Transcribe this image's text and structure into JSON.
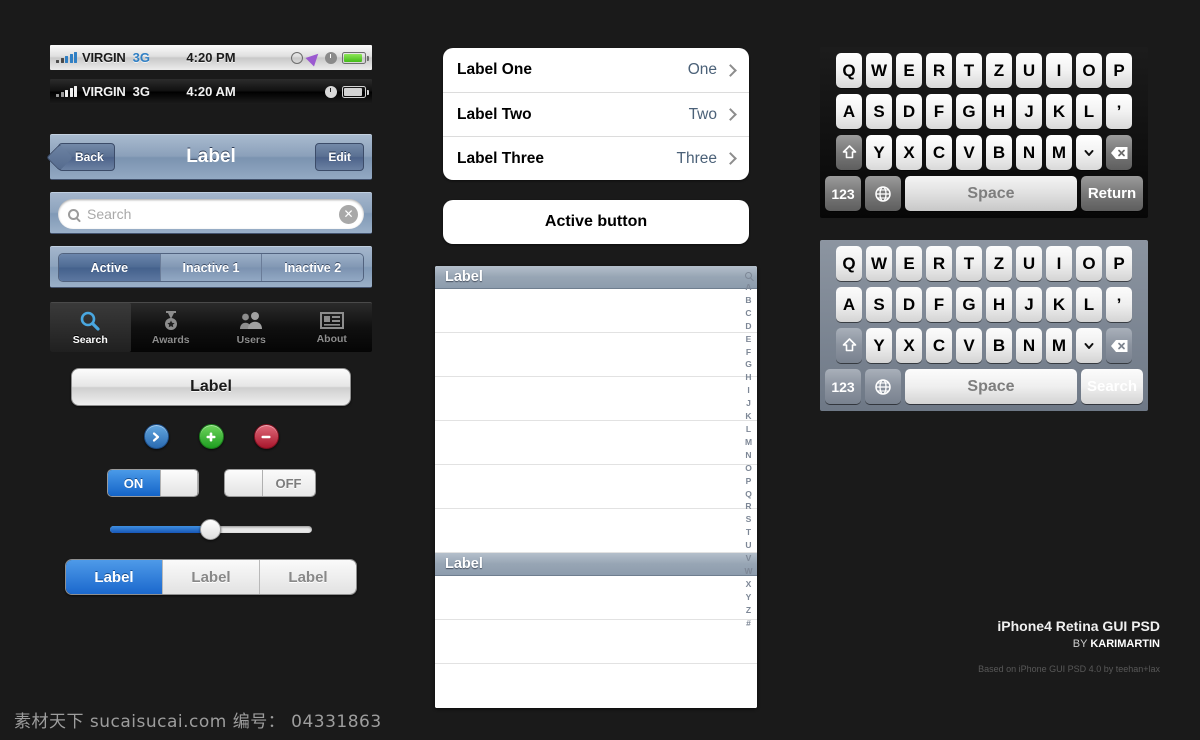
{
  "background": "#1a1a1a",
  "status_bars": [
    {
      "style": "light",
      "carrier": "VIRGIN",
      "network": "3G",
      "time": "4:20 PM",
      "icons": [
        "rotation-lock-icon",
        "location-arrow-icon",
        "alarm-clock-icon",
        "battery-icon"
      ]
    },
    {
      "style": "dark",
      "carrier": "VIRGIN",
      "network": "3G",
      "time": "4:20 AM",
      "icons": [
        "alarm-clock-icon",
        "battery-icon"
      ]
    }
  ],
  "navbar": {
    "back_label": "Back",
    "title": "Label",
    "edit_label": "Edit"
  },
  "searchbar": {
    "placeholder": "Search",
    "value": ""
  },
  "segmented_top": {
    "items": [
      "Active",
      "Inactive 1",
      "Inactive 2"
    ],
    "selected_index": 0
  },
  "tabbar": {
    "items": [
      {
        "label": "Search",
        "icon": "search-icon",
        "active": true
      },
      {
        "label": "Awards",
        "icon": "medal-icon",
        "active": false
      },
      {
        "label": "Users",
        "icon": "users-icon",
        "active": false
      },
      {
        "label": "About",
        "icon": "contact-card-icon",
        "active": false
      }
    ]
  },
  "gray_button": {
    "label": "Label"
  },
  "round_buttons": [
    {
      "name": "disclosure-button",
      "icon": "chevron-right-icon",
      "color": "#2a6ab0"
    },
    {
      "name": "add-button",
      "icon": "plus-icon",
      "color": "#1f9d21"
    },
    {
      "name": "delete-button",
      "icon": "minus-icon",
      "color": "#a8162c"
    }
  ],
  "switches": [
    {
      "state": "on",
      "label": "ON"
    },
    {
      "state": "off",
      "label": "OFF"
    }
  ],
  "slider": {
    "value": 50,
    "min": 0,
    "max": 100
  },
  "segmented_bottom": {
    "items": [
      "Label",
      "Label",
      "Label"
    ],
    "selected_index": 0
  },
  "grouped_table": {
    "rows": [
      {
        "label": "Label One",
        "value": "One"
      },
      {
        "label": "Label Two",
        "value": "Two"
      },
      {
        "label": "Label Three",
        "value": "Three"
      }
    ]
  },
  "active_button": {
    "label": "Active button"
  },
  "plain_table": {
    "section_one_header": "Label",
    "section_two_header": "Label",
    "section_one_row_count": 6,
    "section_two_row_count": 3,
    "index_bar": [
      "A",
      "B",
      "C",
      "D",
      "E",
      "F",
      "G",
      "H",
      "I",
      "J",
      "K",
      "L",
      "M",
      "N",
      "O",
      "P",
      "Q",
      "R",
      "S",
      "T",
      "U",
      "V",
      "W",
      "X",
      "Y",
      "Z",
      "#"
    ],
    "index_search_icon": "search-icon"
  },
  "keyboards": [
    {
      "theme": "dark",
      "row1": [
        "Q",
        "W",
        "E",
        "R",
        "T",
        "Z",
        "U",
        "I",
        "O",
        "P"
      ],
      "row2": [
        "A",
        "S",
        "D",
        "F",
        "G",
        "H",
        "J",
        "K",
        "L",
        "’"
      ],
      "row3": [
        "Y",
        "X",
        "C",
        "V",
        "B",
        "N",
        "M"
      ],
      "shift_icon": "shift-icon",
      "chevron_key_icon": "chevron-down-icon",
      "backspace_icon": "backspace-icon",
      "num_label": "123",
      "globe_icon": "globe-icon",
      "space_label": "Space",
      "action_label": "Return",
      "action_style": "gray"
    },
    {
      "theme": "light",
      "row1": [
        "Q",
        "W",
        "E",
        "R",
        "T",
        "Z",
        "U",
        "I",
        "O",
        "P"
      ],
      "row2": [
        "A",
        "S",
        "D",
        "F",
        "G",
        "H",
        "J",
        "K",
        "L",
        "’"
      ],
      "row3": [
        "Y",
        "X",
        "C",
        "V",
        "B",
        "N",
        "M"
      ],
      "shift_icon": "shift-icon",
      "chevron_key_icon": "chevron-down-icon",
      "backspace_icon": "backspace-icon",
      "num_label": "123",
      "globe_icon": "globe-icon",
      "space_label": "Space",
      "action_label": "Search",
      "action_style": "blue"
    }
  ],
  "credits": {
    "title": "iPhone4 Retina GUI PSD",
    "by_prefix": "BY",
    "author": "KARIMARTIN",
    "based_on": "Based on iPhone GUI PSD 4.0 by teehan+lax"
  },
  "watermark": "素材天下  sucaisucai.com   编号： 04331863"
}
